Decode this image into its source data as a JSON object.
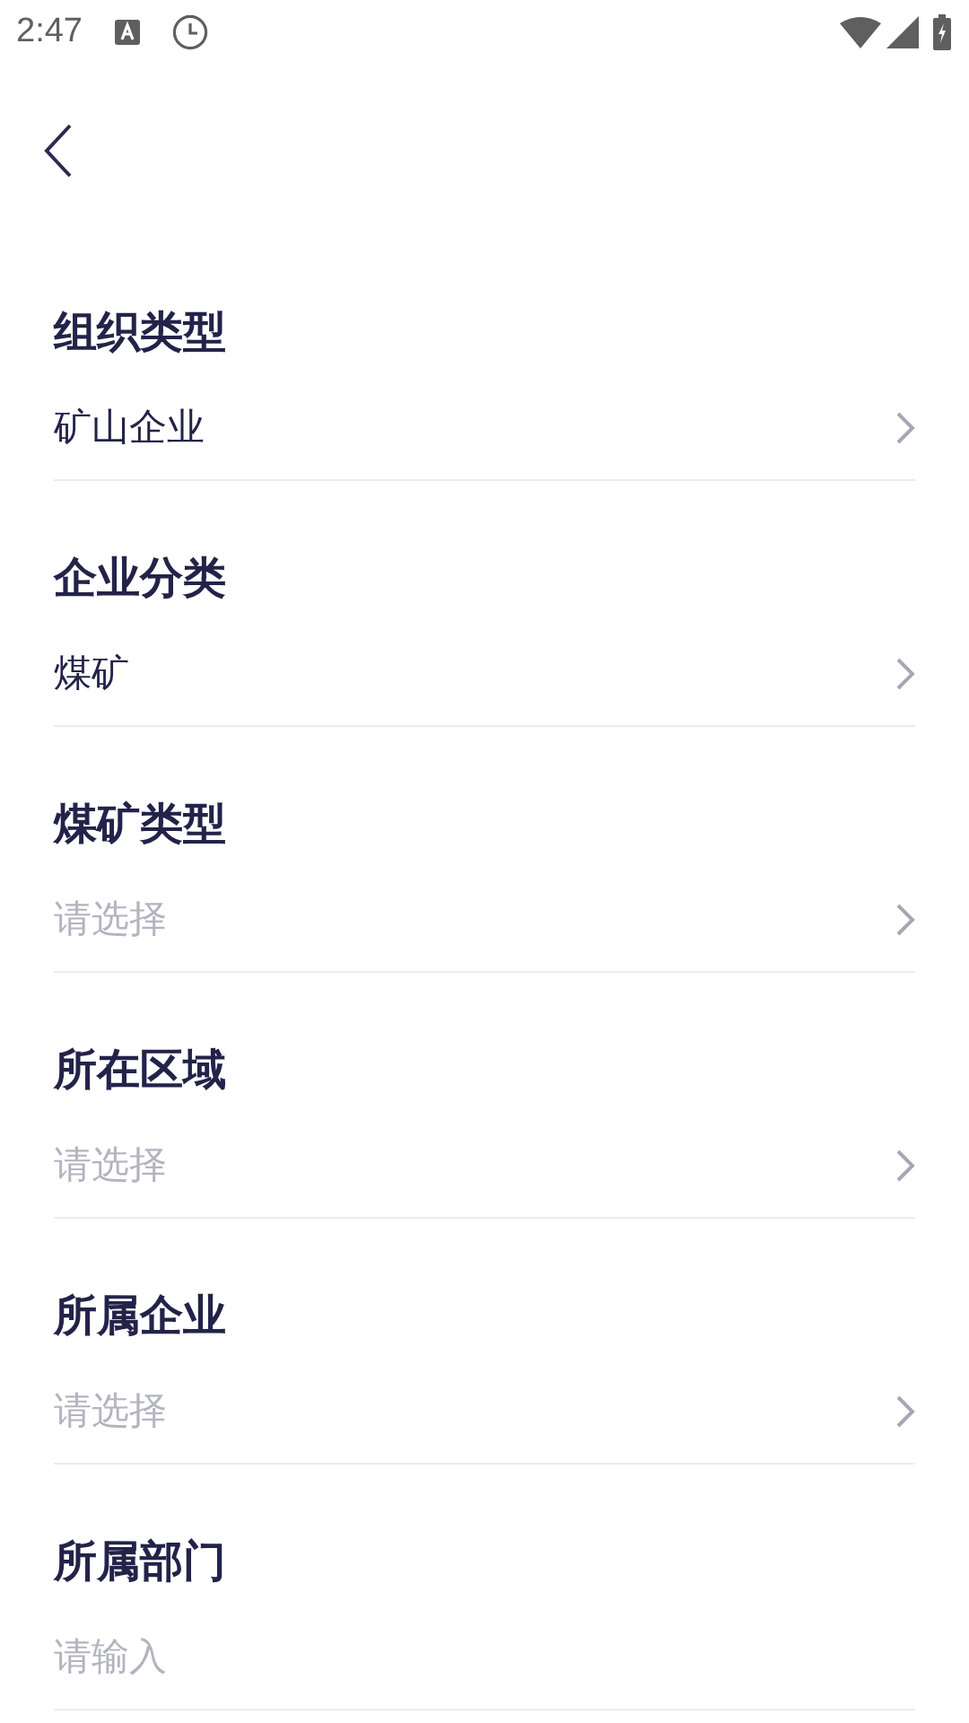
{
  "status_bar": {
    "time": "2:47"
  },
  "fields": [
    {
      "label": "组织类型",
      "kind": "select",
      "value": "矿山企业"
    },
    {
      "label": "企业分类",
      "kind": "select",
      "value": "煤矿"
    },
    {
      "label": "煤矿类型",
      "kind": "select",
      "placeholder": "请选择"
    },
    {
      "label": "所在区域",
      "kind": "select",
      "placeholder": "请选择"
    },
    {
      "label": "所属企业",
      "kind": "select",
      "placeholder": "请选择"
    },
    {
      "label": "所属部门",
      "kind": "input",
      "placeholder": "请输入"
    }
  ]
}
